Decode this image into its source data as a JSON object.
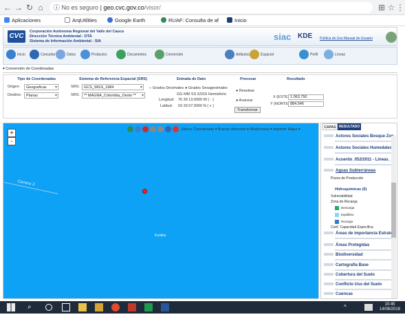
{
  "browser": {
    "insecure_label": "No es seguro",
    "url_host": "geo.cvc.gov.co",
    "url_path": "/visor/",
    "bookmarks": [
      "Aplicaciones",
      "ArqUtilities",
      "Google Earth",
      "RUAF: Consulta de af",
      "Inicio"
    ]
  },
  "header": {
    "logo_text": "CVC",
    "corp_lines": [
      "Corporación Autónoma Regional del Valle del Cauca",
      "Dirección Técnica Ambiental - DTA",
      "Sistema de Información Ambiental - SIA"
    ],
    "siac": "siac",
    "kde": "KDE",
    "links": "Política de Uso  Manual de Usuario"
  },
  "toolbar": {
    "items": [
      "Inicio",
      "Consultar",
      "Datos",
      "Productos",
      "Documentos",
      "Conversión",
      "Atributos",
      "Espacial",
      "Perfil",
      "Líneas"
    ]
  },
  "conversion": {
    "title": "Conversión de Coordenadas",
    "coord_type_header": "Tipo de Coordenadas",
    "srs_header": "Sistema de Referencia Espacial (SRS)",
    "input_header": "Entrada de Dato",
    "process_header": "Procesar",
    "result_header": "Resultado",
    "origin_label": "Origen:",
    "origin_value": "Geograficas",
    "dest_label": "Destino:",
    "dest_value": "Planas",
    "srs_label": "SRS:",
    "srs_origin": "GCS_WGS_1984",
    "srs_dest": "** MAGNA_Colombia_Oeste **",
    "mode_decimal": "Grados Decimales",
    "mode_sexag": "Grados Sexagesimales",
    "cols": "GG  MM  SS.SSSS  Hemisferio",
    "lon_label": "Longitud:",
    "lon_values": "76    39    13.0000    W ( - )",
    "lat_label": "Latitud:",
    "lat_values": "03    33    07.0000    N ( + )",
    "opt_reset": "Resetear",
    "opt_advance": "Avanzar",
    "transform_button": "Transformar",
    "este_label": "X (ESTE):",
    "este_value": "1.063.750",
    "norte_label": "Y (NORTE):",
    "norte_value": "884.546"
  },
  "map": {
    "zoom_in": "+",
    "zoom_out": "-",
    "tools_text": "Ubicar Coordenada ▾   Buscar dirección ▾   Mediciones ▾   Imprimir Mapa ▾",
    "road_label": "Carrera 3",
    "place_label": "Kunikio"
  },
  "layers": {
    "tab_layers": "CAPAS",
    "tab_results": "RESULTADO",
    "items": [
      "Actores Sociales Bosque Zon",
      "Actores Sociales Humedales",
      "Acuerdo_052/2011 - Lineas_",
      "Aguas Subterráneas",
      "Pozos de Producción",
      "Hidroquímicas (5)",
      "Vulnerabilidad",
      "Zona de Recarga",
      "Descarga",
      "Equilibrio",
      "Recarga",
      "Coef. Capacidad Específica",
      "Áreas de importancia Estraté",
      "Áreas Protegidas",
      "Biodiversidad",
      "Cartografía Base",
      "Cobertura del Suelo",
      "Conflicto Uso del Suelo",
      "Cuencas"
    ],
    "swatch_colors": [
      "#2aa86a",
      "#8fd4f2",
      "#2f7dc8"
    ]
  },
  "taskbar": {
    "time": "10:45",
    "date": "14/08/2018"
  }
}
